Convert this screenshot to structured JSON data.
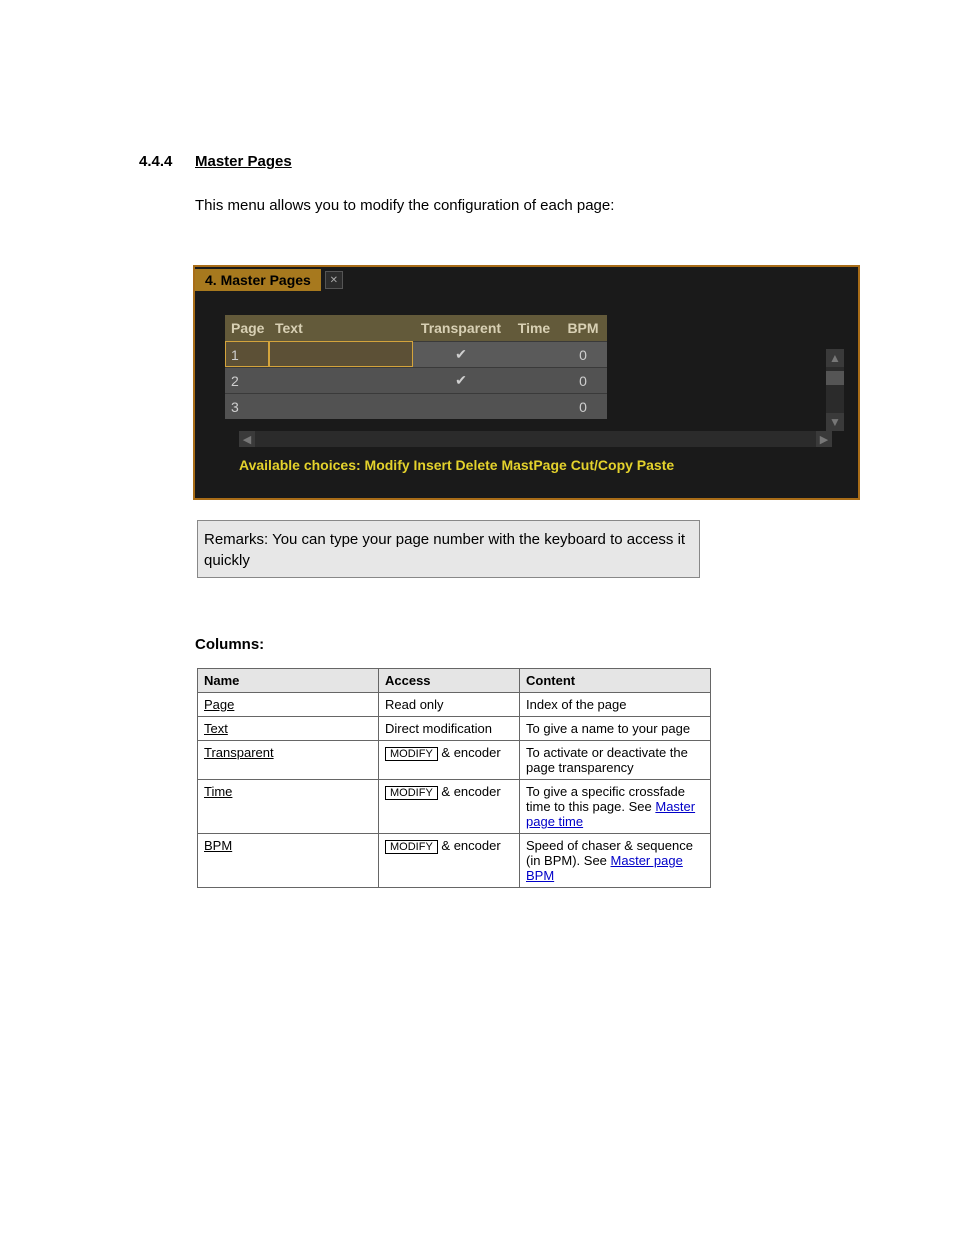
{
  "section": {
    "number": "4.4.4",
    "title": "Master Pages"
  },
  "intro": "This menu allows you to modify the configuration of each page:",
  "panel": {
    "tab": "4. Master Pages",
    "headers": {
      "page": "Page",
      "text": "Text",
      "transparent": "Transparent",
      "time": "Time",
      "bpm": "BPM"
    },
    "rows": [
      {
        "page": "1",
        "text": "",
        "transparent": "✔",
        "time": "",
        "bpm": "0"
      },
      {
        "page": "2",
        "text": "",
        "transparent": "✔",
        "time": "",
        "bpm": "0"
      },
      {
        "page": "3",
        "text": "",
        "transparent": "",
        "time": "",
        "bpm": "0"
      }
    ],
    "choices": "Available choices: Modify Insert Delete MastPage Cut/Copy Paste"
  },
  "note": "Remarks: You can type your page number with the keyboard to access it quickly",
  "columns_label": "Columns:",
  "modify_label": "MODIFY",
  "columns": [
    {
      "name": "Page",
      "access": "Read only",
      "content": "Index of the page"
    },
    {
      "name": "Text",
      "access": "Direct modification",
      "content": "To give a name to your page"
    },
    {
      "name": "Transparent",
      "access_prefix": "& encoder",
      "content": "To activate or deactivate the page transparency"
    },
    {
      "name": "Time",
      "access_prefix": "& encoder",
      "link": "Master page time",
      "content_prefix": "To give a specific crossfade time to this page. See ",
      "content_suffix": ""
    },
    {
      "name": "BPM",
      "access_prefix": "& encoder",
      "link": "Master page BPM",
      "content_prefix": "Speed of chaser & sequence (in BPM). See ",
      "content_suffix": ""
    }
  ]
}
